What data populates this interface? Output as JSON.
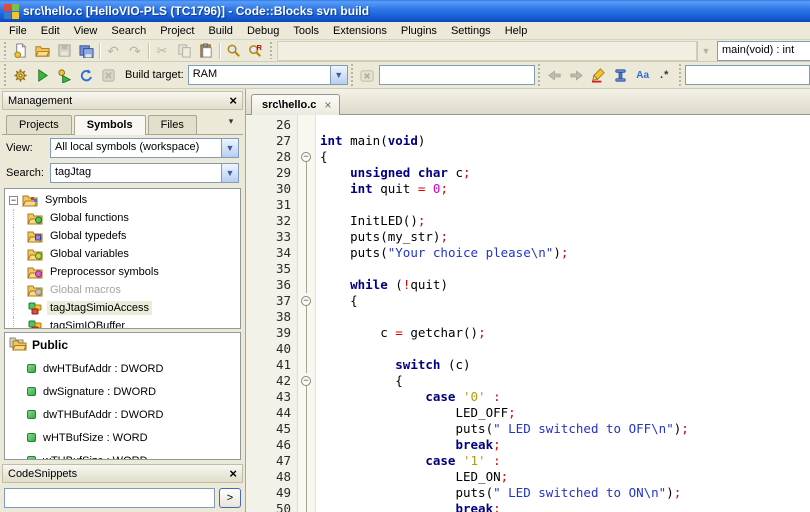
{
  "window": {
    "title": "src\\hello.c [HelloVIO-PLS (TC1796)] - Code::Blocks svn build",
    "app_icon": "codeblocks-icon"
  },
  "menu": {
    "items": [
      "File",
      "Edit",
      "View",
      "Search",
      "Project",
      "Build",
      "Debug",
      "Tools",
      "Extensions",
      "Plugins",
      "Settings",
      "Help"
    ]
  },
  "toolbar_main": {
    "icons": [
      {
        "name": "new-file",
        "enabled": true
      },
      {
        "name": "open-file",
        "enabled": true
      },
      {
        "name": "save",
        "enabled": false
      },
      {
        "name": "save-all",
        "enabled": true
      },
      {
        "name": "sep"
      },
      {
        "name": "undo",
        "enabled": false
      },
      {
        "name": "redo",
        "enabled": false
      },
      {
        "name": "sep"
      },
      {
        "name": "cut",
        "enabled": false
      },
      {
        "name": "copy",
        "enabled": false
      },
      {
        "name": "paste",
        "enabled": true
      },
      {
        "name": "sep"
      },
      {
        "name": "find",
        "enabled": true
      },
      {
        "name": "replace",
        "enabled": true
      }
    ],
    "scope_combo_value": "",
    "symbol_combo_value": "main(void) : int"
  },
  "toolbar_build": {
    "icons": [
      {
        "name": "compile",
        "enabled": true
      },
      {
        "name": "run",
        "enabled": true
      },
      {
        "name": "build-run",
        "enabled": true
      },
      {
        "name": "rebuild",
        "enabled": true
      },
      {
        "name": "abort",
        "enabled": false
      }
    ],
    "build_target_label": "Build target:",
    "build_target_value": "RAM",
    "clear-search-icon": "combo-x",
    "incsearch_value": "",
    "incsearch_icons": [
      {
        "name": "prev",
        "enabled": false
      },
      {
        "name": "next",
        "enabled": false
      },
      {
        "name": "highlight",
        "enabled": true
      },
      {
        "name": "selected-only",
        "enabled": true
      },
      {
        "name": "match-case",
        "enabled": true
      },
      {
        "name": "regex",
        "enabled": true
      }
    ],
    "second_search_value": ""
  },
  "management": {
    "title": "Management",
    "close_label": "×",
    "tab_list_icon": "▾",
    "tabs": [
      {
        "label": "Projects",
        "active": false
      },
      {
        "label": "Symbols",
        "active": true
      },
      {
        "label": "Files",
        "active": false
      }
    ],
    "view_label": "View:",
    "view_value": "All local symbols (workspace)",
    "search_label": "Search:",
    "search_value": "tagJtag",
    "tree_root": {
      "label": "Symbols",
      "expander": "-",
      "icon": "folder-root"
    },
    "tree_items": [
      {
        "label": "Global functions",
        "icon": "folder-functions",
        "disabled": false,
        "selected": false
      },
      {
        "label": "Global typedefs",
        "icon": "folder-typedefs",
        "disabled": false,
        "selected": false
      },
      {
        "label": "Global variables",
        "icon": "folder-variables",
        "disabled": false,
        "selected": false
      },
      {
        "label": "Preprocessor symbols",
        "icon": "folder-preprocessor",
        "disabled": false,
        "selected": false
      },
      {
        "label": "Global macros",
        "icon": "folder-macros",
        "disabled": true,
        "selected": false
      },
      {
        "label": "tagJtagSimioAccess",
        "icon": "class",
        "disabled": false,
        "selected": true
      },
      {
        "label": "tagSimIOBuffer",
        "icon": "class",
        "disabled": false,
        "selected": false
      }
    ]
  },
  "public_panel": {
    "title": "Public",
    "items": [
      "dwHTBufAddr : DWORD",
      "dwSignature : DWORD",
      "dwTHBufAddr : DWORD",
      "wHTBufSize : WORD",
      "wTHBufSize : WORD"
    ]
  },
  "codesnippets": {
    "title": "CodeSnippets",
    "close_label": "×",
    "input_value": "",
    "go_label": ">"
  },
  "editor": {
    "tab_label": "src\\hello.c",
    "tab_close": "×",
    "lines": [
      {
        "n": "26",
        "f": "",
        "t": []
      },
      {
        "n": "27",
        "f": "",
        "t": [
          [
            "k",
            "int"
          ],
          [
            "b",
            " "
          ],
          [
            "i",
            "main"
          ],
          [
            "b",
            "("
          ],
          [
            "k",
            "void"
          ],
          [
            "b",
            ")"
          ]
        ]
      },
      {
        "n": "28",
        "f": "m",
        "t": [
          [
            "b",
            "{"
          ]
        ]
      },
      {
        "n": "29",
        "f": "l",
        "t": [
          [
            "b",
            "    "
          ],
          [
            "k",
            "unsigned"
          ],
          [
            "b",
            " "
          ],
          [
            "k",
            "char"
          ],
          [
            "b",
            " "
          ],
          [
            "i",
            "c"
          ],
          [
            "o",
            ";"
          ]
        ]
      },
      {
        "n": "30",
        "f": "l",
        "t": [
          [
            "b",
            "    "
          ],
          [
            "k",
            "int"
          ],
          [
            "b",
            " "
          ],
          [
            "i",
            "quit"
          ],
          [
            "b",
            " "
          ],
          [
            "o",
            "="
          ],
          [
            "b",
            " "
          ],
          [
            "n",
            "0"
          ],
          [
            "o",
            ";"
          ]
        ]
      },
      {
        "n": "31",
        "f": "l",
        "t": []
      },
      {
        "n": "32",
        "f": "l",
        "t": [
          [
            "b",
            "    "
          ],
          [
            "i",
            "InitLED"
          ],
          [
            "b",
            "()"
          ],
          [
            "o",
            ";"
          ]
        ]
      },
      {
        "n": "33",
        "f": "l",
        "t": [
          [
            "b",
            "    "
          ],
          [
            "i",
            "puts"
          ],
          [
            "b",
            "("
          ],
          [
            "i",
            "my_str"
          ],
          [
            "b",
            ")"
          ],
          [
            "o",
            ";"
          ]
        ]
      },
      {
        "n": "34",
        "f": "l",
        "t": [
          [
            "b",
            "    "
          ],
          [
            "i",
            "puts"
          ],
          [
            "b",
            "("
          ],
          [
            "s",
            "\"Your choice please\\n\""
          ],
          [
            "b",
            ")"
          ],
          [
            "o",
            ";"
          ]
        ]
      },
      {
        "n": "35",
        "f": "l",
        "t": []
      },
      {
        "n": "36",
        "f": "l",
        "t": [
          [
            "b",
            "    "
          ],
          [
            "k",
            "while"
          ],
          [
            "b",
            " ("
          ],
          [
            "o",
            "!"
          ],
          [
            "i",
            "quit"
          ],
          [
            "b",
            ")"
          ]
        ]
      },
      {
        "n": "37",
        "f": "m",
        "t": [
          [
            "b",
            "    {"
          ]
        ]
      },
      {
        "n": "38",
        "f": "l",
        "t": []
      },
      {
        "n": "39",
        "f": "l",
        "t": [
          [
            "b",
            "        "
          ],
          [
            "i",
            "c"
          ],
          [
            "b",
            " "
          ],
          [
            "o",
            "="
          ],
          [
            "b",
            " "
          ],
          [
            "i",
            "getchar"
          ],
          [
            "b",
            "()"
          ],
          [
            "o",
            ";"
          ]
        ]
      },
      {
        "n": "40",
        "f": "l",
        "t": []
      },
      {
        "n": "41",
        "f": "l",
        "t": [
          [
            "b",
            "          "
          ],
          [
            "k",
            "switch"
          ],
          [
            "b",
            " ("
          ],
          [
            "i",
            "c"
          ],
          [
            "b",
            ")"
          ]
        ]
      },
      {
        "n": "42",
        "f": "m",
        "t": [
          [
            "b",
            "          {"
          ]
        ]
      },
      {
        "n": "43",
        "f": "l",
        "t": [
          [
            "b",
            "              "
          ],
          [
            "k",
            "case"
          ],
          [
            "b",
            " "
          ],
          [
            "c",
            "'0'"
          ],
          [
            "b",
            " "
          ],
          [
            "o",
            ":"
          ]
        ]
      },
      {
        "n": "44",
        "f": "l",
        "t": [
          [
            "b",
            "                  "
          ],
          [
            "i",
            "LED_OFF"
          ],
          [
            "o",
            ";"
          ]
        ]
      },
      {
        "n": "45",
        "f": "l",
        "t": [
          [
            "b",
            "                  "
          ],
          [
            "i",
            "puts"
          ],
          [
            "b",
            "("
          ],
          [
            "s",
            "\" LED switched to OFF\\n\""
          ],
          [
            "b",
            ")"
          ],
          [
            "o",
            ";"
          ]
        ]
      },
      {
        "n": "46",
        "f": "l",
        "t": [
          [
            "b",
            "                  "
          ],
          [
            "k",
            "break"
          ],
          [
            "o",
            ";"
          ]
        ]
      },
      {
        "n": "47",
        "f": "l",
        "t": [
          [
            "b",
            "              "
          ],
          [
            "k",
            "case"
          ],
          [
            "b",
            " "
          ],
          [
            "c",
            "'1'"
          ],
          [
            "b",
            " "
          ],
          [
            "o",
            ":"
          ]
        ]
      },
      {
        "n": "48",
        "f": "l",
        "t": [
          [
            "b",
            "                  "
          ],
          [
            "i",
            "LED_ON"
          ],
          [
            "o",
            ";"
          ]
        ]
      },
      {
        "n": "49",
        "f": "l",
        "t": [
          [
            "b",
            "                  "
          ],
          [
            "i",
            "puts"
          ],
          [
            "b",
            "("
          ],
          [
            "s",
            "\" LED switched to ON\\n\""
          ],
          [
            "b",
            ")"
          ],
          [
            "o",
            ";"
          ]
        ]
      },
      {
        "n": "50",
        "f": "l",
        "t": [
          [
            "b",
            "                  "
          ],
          [
            "k",
            "break"
          ],
          [
            "o",
            ";"
          ]
        ]
      }
    ]
  }
}
